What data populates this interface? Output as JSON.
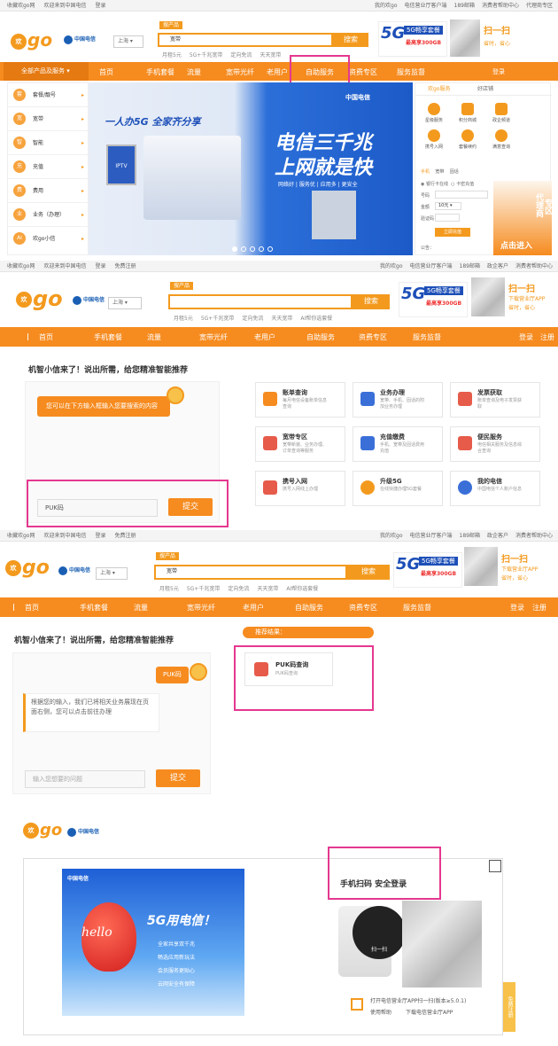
{
  "topbar": {
    "fav": "收藏欢go网",
    "welcome": "欢迎来到中国电信",
    "login": "登录",
    "register": "免费注册",
    "my": "我的欢go",
    "app": "电信营业厅客户端",
    "mail": "189邮箱",
    "gov": "政企客户",
    "help": "消费者帮助中心",
    "agent": "代理商专区"
  },
  "header": {
    "logo": "go",
    "logo_yb": "欢",
    "ct": "中国电信",
    "city": "上海",
    "search_tab": "搜产品",
    "search_value": "宽带",
    "search_value2": "PUK码",
    "search_btn": "搜索",
    "hot": [
      "月租5元",
      "5G+千兆宽带",
      "定向免流",
      "天天宽带",
      "AI帮你选套餐"
    ],
    "ad_big": "5G",
    "ad_t1": "5G畅享套餐",
    "ad_t2": "最高享300GB",
    "scan": "扫一扫",
    "scan_sub": "下载营业厅APP",
    "scan_sub2": "省时，省心"
  },
  "nav": {
    "all": "全部产品及服务",
    "home": "首页",
    "phone": "手机套餐",
    "flow": "流量",
    "broadband": "宽带光纤",
    "old": "老用户",
    "self": "自助服务",
    "tariff": "资费专区",
    "supervise": "服务监督",
    "login": "登录",
    "register": "注册"
  },
  "sidebar": [
    {
      "label": "套餐/靓号",
      "icon": "套"
    },
    {
      "label": "宽带",
      "icon": "宽"
    },
    {
      "label": "智能",
      "icon": "智"
    },
    {
      "label": "充值",
      "icon": "充"
    },
    {
      "label": "费用",
      "icon": "费"
    },
    {
      "label": "业务（办理）",
      "icon": "业"
    },
    {
      "label": "欢go小信",
      "icon": "AI"
    }
  ],
  "banner": {
    "left_title": "一人办5G 全家齐分享",
    "right_title1": "电信三千兆",
    "right_title2": "上网就是快",
    "features": [
      "网络好",
      "服务优",
      "应用多",
      "更安全"
    ],
    "ct": "中国电信",
    "tv": "IPTV"
  },
  "panel": {
    "tab1": "欢go服务",
    "tab2": "好店铺",
    "icons": [
      "星级服务",
      "积分商城",
      "政企频道",
      "携号入网",
      "套餐续约",
      "满意查询"
    ],
    "rtabs": [
      "手机",
      "宽带",
      "固话"
    ],
    "radio1": "银行卡在线",
    "radio2": "卡密充值",
    "phone_label": "号码",
    "amount_label": "金额",
    "amount_value": "10元",
    "code_label": "验证码",
    "pay_btn": "立即充值",
    "notice": "公告：",
    "agent_title": "代理商",
    "agent_zone": "专区",
    "agent_enter": "点击进入"
  },
  "assist": {
    "title": "机智小信来了！说出所需，给您精准智能推荐",
    "bubble": "您可以在下方输入框输入您要搜索的内容",
    "input_value": "PUK码",
    "submit": "提交",
    "placeholder": "输入您想要的问题",
    "user_msg": "PUK码",
    "reply": "根据您的输入，我们已将相关业务展现在页面右侧，您可以点击前往办理",
    "result_title": "推荐结果：",
    "result_card_title": "PUK码查询",
    "result_card_desc": "PUK码查询"
  },
  "services": [
    {
      "title": "账单查询",
      "desc": "每月电信设备账单信息查询",
      "color": "#f68b1f"
    },
    {
      "title": "业务办理",
      "desc": "宽带、手机、固话的附加业务办理",
      "color": "#3a6fd8"
    },
    {
      "title": "发票获取",
      "desc": "账单查询及电子发票获取",
      "color": "#e65b4a"
    },
    {
      "title": "宽带专区",
      "desc": "宽带新装、业务办理、订单查询等服务",
      "color": "#e65b4a"
    },
    {
      "title": "充值缴费",
      "desc": "手机、宽带及固话费用充值",
      "color": "#3a6fd8"
    },
    {
      "title": "便民服务",
      "desc": "电信相关服务及信息综合查询",
      "color": "#e65b4a"
    },
    {
      "title": "携号入网",
      "desc": "携号入网线上办理",
      "color": "#e65b4a"
    },
    {
      "title": "升级5G",
      "desc": "在线快捷办理5G套餐",
      "color": "#f39a1e"
    },
    {
      "title": "我的电信",
      "desc": "中国电信个人账户信息",
      "color": "#3a6fd8"
    }
  ],
  "login": {
    "hello": "hello",
    "big": "5G用电信！",
    "list": [
      "全家共享双千兆",
      "畅选应用新玩法",
      "会员服务更贴心",
      "云网安全有保障"
    ],
    "qr_title": "手机扫码 安全登录",
    "open_app": "打开电信营业厅APP扫一扫(版本≥5.0.1)",
    "use_help": "使用帮助",
    "download": "下载电信营业厅APP",
    "scan_word": "扫一扫",
    "side_tab": "免费注册"
  },
  "colors": {
    "brand": "#f68b1f",
    "highlight": "#e4388f",
    "ct_blue": "#1a5fb4"
  }
}
